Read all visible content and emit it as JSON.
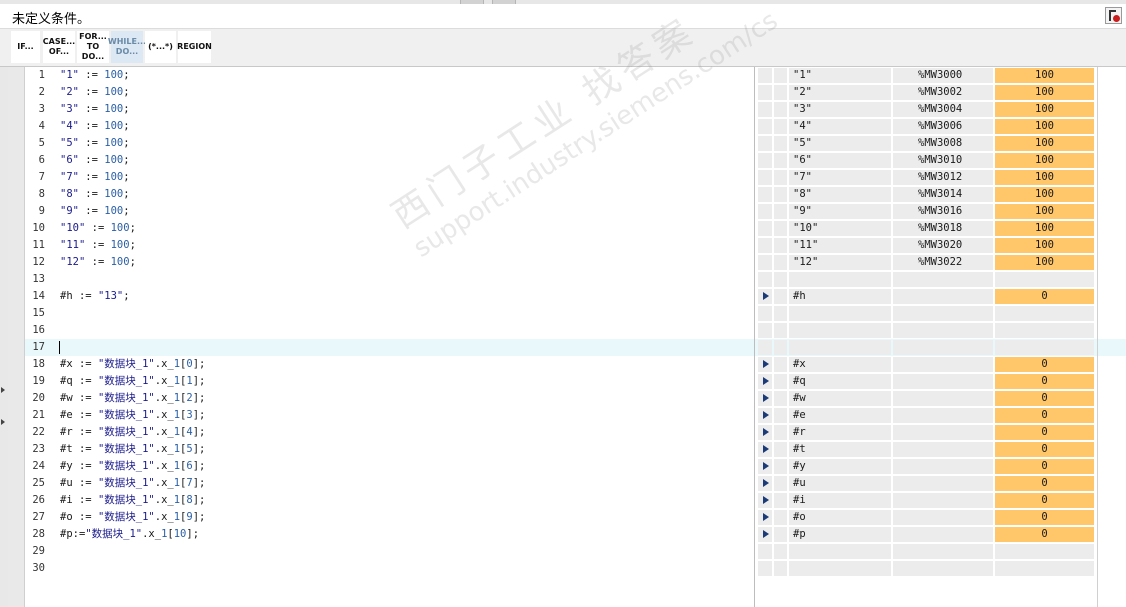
{
  "window": {
    "title": "未定义条件。"
  },
  "toolbar": {
    "buttons": [
      {
        "label": "IF..."
      },
      {
        "label": "CASE... OF..."
      },
      {
        "label": "FOR... TO DO..."
      },
      {
        "label": "WHILE... DO..."
      },
      {
        "label": "(*...*)"
      },
      {
        "label": "REGION"
      }
    ],
    "active_index": 3
  },
  "code_lines": [
    {
      "n": "1",
      "text": "\"1\" := 100;"
    },
    {
      "n": "2",
      "text": "\"2\" := 100;"
    },
    {
      "n": "3",
      "text": "\"3\" := 100;"
    },
    {
      "n": "4",
      "text": "\"4\" := 100;"
    },
    {
      "n": "5",
      "text": "\"5\" := 100;"
    },
    {
      "n": "6",
      "text": "\"6\" := 100;"
    },
    {
      "n": "7",
      "text": "\"7\" := 100;"
    },
    {
      "n": "8",
      "text": "\"8\" := 100;"
    },
    {
      "n": "9",
      "text": "\"9\" := 100;"
    },
    {
      "n": "10",
      "text": "\"10\" := 100;"
    },
    {
      "n": "11",
      "text": "\"11\" := 100;"
    },
    {
      "n": "12",
      "text": "\"12\" := 100;"
    },
    {
      "n": "13",
      "text": ""
    },
    {
      "n": "14",
      "text": "#h := \"13\";"
    },
    {
      "n": "15",
      "text": ""
    },
    {
      "n": "16",
      "text": ""
    },
    {
      "n": "17",
      "text": ""
    },
    {
      "n": "18",
      "text": "#x := \"数据块_1\".x_1[0];"
    },
    {
      "n": "19",
      "text": "#q := \"数据块_1\".x_1[1];"
    },
    {
      "n": "20",
      "text": "#w := \"数据块_1\".x_1[2];"
    },
    {
      "n": "21",
      "text": "#e := \"数据块_1\".x_1[3];"
    },
    {
      "n": "22",
      "text": "#r := \"数据块_1\".x_1[4];"
    },
    {
      "n": "23",
      "text": "#t := \"数据块_1\".x_1[5];"
    },
    {
      "n": "24",
      "text": "#y := \"数据块_1\".x_1[6];"
    },
    {
      "n": "25",
      "text": "#u := \"数据块_1\".x_1[7];"
    },
    {
      "n": "26",
      "text": "#i := \"数据块_1\".x_1[8];"
    },
    {
      "n": "27",
      "text": "#o := \"数据块_1\".x_1[9];"
    },
    {
      "n": "28",
      "text": "#p:=\"数据块_1\".x_1[10];"
    },
    {
      "n": "29",
      "text": ""
    },
    {
      "n": "30",
      "text": ""
    }
  ],
  "current_line": 17,
  "monitor_rows": [
    {
      "arrow": false,
      "name": "\"1\"",
      "addr": "%MW3000",
      "value": "100"
    },
    {
      "arrow": false,
      "name": "\"2\"",
      "addr": "%MW3002",
      "value": "100"
    },
    {
      "arrow": false,
      "name": "\"3\"",
      "addr": "%MW3004",
      "value": "100"
    },
    {
      "arrow": false,
      "name": "\"4\"",
      "addr": "%MW3006",
      "value": "100"
    },
    {
      "arrow": false,
      "name": "\"5\"",
      "addr": "%MW3008",
      "value": "100"
    },
    {
      "arrow": false,
      "name": "\"6\"",
      "addr": "%MW3010",
      "value": "100"
    },
    {
      "arrow": false,
      "name": "\"7\"",
      "addr": "%MW3012",
      "value": "100"
    },
    {
      "arrow": false,
      "name": "\"8\"",
      "addr": "%MW3014",
      "value": "100"
    },
    {
      "arrow": false,
      "name": "\"9\"",
      "addr": "%MW3016",
      "value": "100"
    },
    {
      "arrow": false,
      "name": "\"10\"",
      "addr": "%MW3018",
      "value": "100"
    },
    {
      "arrow": false,
      "name": "\"11\"",
      "addr": "%MW3020",
      "value": "100"
    },
    {
      "arrow": false,
      "name": "\"12\"",
      "addr": "%MW3022",
      "value": "100"
    },
    {
      "arrow": false,
      "name": "",
      "addr": "",
      "value": ""
    },
    {
      "arrow": true,
      "name": "#h",
      "addr": "",
      "value": "0"
    },
    {
      "arrow": false,
      "name": "",
      "addr": "",
      "value": ""
    },
    {
      "arrow": false,
      "name": "",
      "addr": "",
      "value": ""
    },
    {
      "arrow": false,
      "name": "",
      "addr": "",
      "value": ""
    },
    {
      "arrow": true,
      "name": "#x",
      "addr": "",
      "value": "0"
    },
    {
      "arrow": true,
      "name": "#q",
      "addr": "",
      "value": "0"
    },
    {
      "arrow": true,
      "name": "#w",
      "addr": "",
      "value": "0"
    },
    {
      "arrow": true,
      "name": "#e",
      "addr": "",
      "value": "0"
    },
    {
      "arrow": true,
      "name": "#r",
      "addr": "",
      "value": "0"
    },
    {
      "arrow": true,
      "name": "#t",
      "addr": "",
      "value": "0"
    },
    {
      "arrow": true,
      "name": "#y",
      "addr": "",
      "value": "0"
    },
    {
      "arrow": true,
      "name": "#u",
      "addr": "",
      "value": "0"
    },
    {
      "arrow": true,
      "name": "#i",
      "addr": "",
      "value": "0"
    },
    {
      "arrow": true,
      "name": "#o",
      "addr": "",
      "value": "0"
    },
    {
      "arrow": true,
      "name": "#p",
      "addr": "",
      "value": "0"
    },
    {
      "arrow": false,
      "name": "",
      "addr": "",
      "value": ""
    },
    {
      "arrow": false,
      "name": "",
      "addr": "",
      "value": ""
    }
  ],
  "watermark": {
    "line1": "西门子工业 找答案",
    "line2": "support.industry.siemens.com/cs"
  },
  "colors": {
    "monitor_value_bg": "#ffc76a",
    "current_line_bg": "#e9f8fb",
    "string_color": "#1a1a8c",
    "number_color": "#2a5fa6",
    "monitor_arrow": "#1b3a78"
  }
}
